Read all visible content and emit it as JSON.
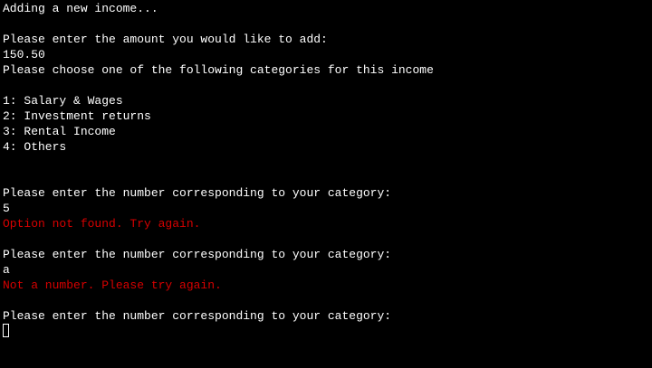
{
  "terminal": {
    "lines": [
      {
        "text": "Adding a new income...",
        "type": "output"
      },
      {
        "text": "",
        "type": "blank"
      },
      {
        "text": "Please enter the amount you would like to add:",
        "type": "prompt"
      },
      {
        "text": "150.50",
        "type": "input"
      },
      {
        "text": "Please choose one of the following categories for this income",
        "type": "output"
      },
      {
        "text": "",
        "type": "blank"
      },
      {
        "text": "1: Salary & Wages",
        "type": "option"
      },
      {
        "text": "2: Investment returns",
        "type": "option"
      },
      {
        "text": "3: Rental Income",
        "type": "option"
      },
      {
        "text": "4: Others",
        "type": "option"
      },
      {
        "text": "",
        "type": "blank"
      },
      {
        "text": "",
        "type": "blank"
      },
      {
        "text": "Please enter the number corresponding to your category:",
        "type": "prompt"
      },
      {
        "text": "5",
        "type": "input"
      },
      {
        "text": "Option not found. Try again.",
        "type": "error"
      },
      {
        "text": "",
        "type": "blank"
      },
      {
        "text": "Please enter the number corresponding to your category:",
        "type": "prompt"
      },
      {
        "text": "a",
        "type": "input"
      },
      {
        "text": "Not a number. Please try again.",
        "type": "error"
      },
      {
        "text": "",
        "type": "blank"
      },
      {
        "text": "Please enter the number corresponding to your category:",
        "type": "prompt"
      }
    ]
  },
  "colors": {
    "background": "#000000",
    "text": "#ffffff",
    "error": "#d60000"
  }
}
